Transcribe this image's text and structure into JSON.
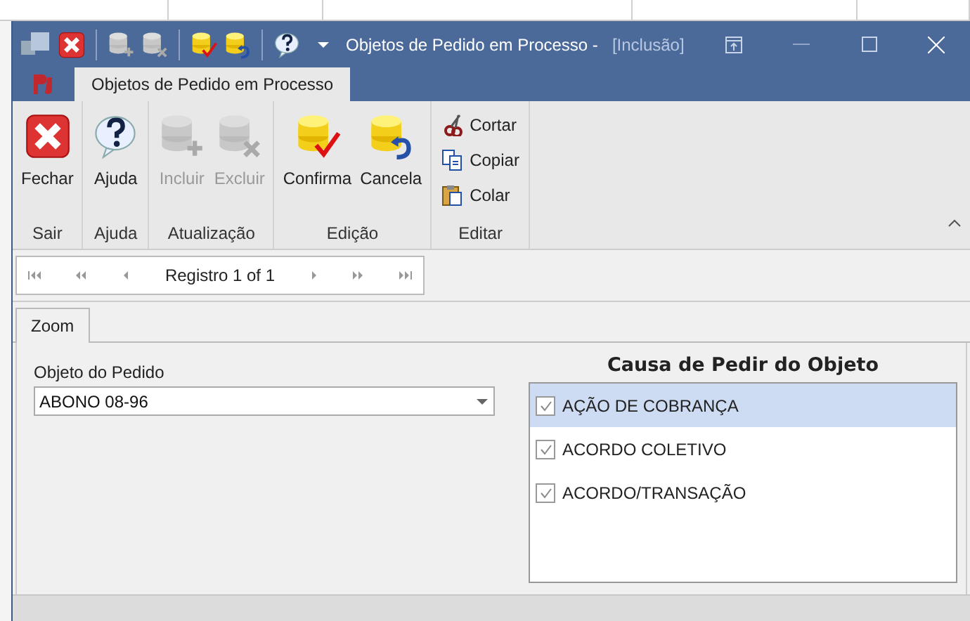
{
  "window": {
    "title": "Objetos de Pedido em Processo -",
    "mode": "[Inclusão]"
  },
  "ribbon": {
    "tabs": [
      {
        "label": "Objetos de Pedido em Processo",
        "selected": true
      }
    ],
    "groups": [
      {
        "label": "Sair",
        "buttons": [
          {
            "kind": "large",
            "label": "Fechar",
            "disabled": false
          }
        ]
      },
      {
        "label": "Ajuda",
        "buttons": [
          {
            "kind": "large",
            "label": "Ajuda",
            "disabled": false
          }
        ]
      },
      {
        "label": "Atualização",
        "buttons": [
          {
            "kind": "large",
            "label": "Incluir",
            "disabled": true
          },
          {
            "kind": "large",
            "label": "Excluir",
            "disabled": true
          }
        ]
      },
      {
        "label": "Edição",
        "buttons": [
          {
            "kind": "large",
            "label": "Confirma",
            "disabled": false
          },
          {
            "kind": "large",
            "label": "Cancela",
            "disabled": false
          }
        ]
      },
      {
        "label": "Editar",
        "buttons": [
          {
            "kind": "small",
            "label": "Cortar",
            "disabled": false
          },
          {
            "kind": "small",
            "label": "Copiar",
            "disabled": false
          },
          {
            "kind": "small",
            "label": "Colar",
            "disabled": false
          }
        ]
      }
    ]
  },
  "navigator": {
    "text": "Registro 1 of 1"
  },
  "form_tabs": [
    {
      "label": "Zoom",
      "selected": true
    }
  ],
  "field": {
    "label": "Objeto do Pedido",
    "value": "ABONO 08-96"
  },
  "list": {
    "title": "Causa de Pedir do Objeto",
    "items": [
      {
        "label": "AÇÃO DE COBRANÇA",
        "checked": true,
        "selected": true
      },
      {
        "label": "ACORDO COLETIVO",
        "checked": true,
        "selected": false
      },
      {
        "label": "ACORDO/TRANSAÇÃO",
        "checked": true,
        "selected": false
      }
    ]
  }
}
